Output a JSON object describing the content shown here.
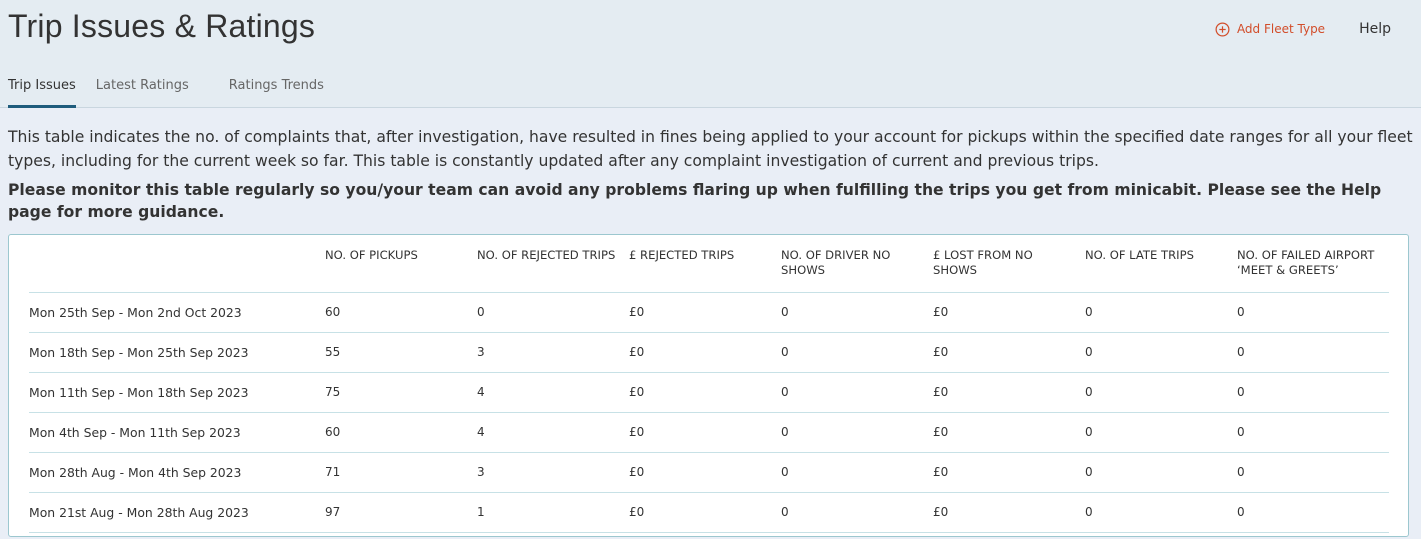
{
  "header": {
    "title": "Trip Issues & Ratings",
    "add_fleet_label": "Add Fleet Type",
    "help_label": "Help"
  },
  "tabs": [
    {
      "label": "Trip Issues",
      "active": true
    },
    {
      "label": "Latest Ratings",
      "active": false
    },
    {
      "label": "Ratings Trends",
      "active": false
    }
  ],
  "intro": {
    "description": "This table indicates the no. of complaints that, after investigation, have resulted in fines being applied to your account for pickups within the specified date ranges for all your fleet types, including for the current week so far. This table is constantly updated after any complaint investigation of current and previous trips.",
    "note": "Please monitor this table regularly so you/your team can avoid any problems flaring up when fulfilling the trips you get from minicabit. Please see the Help page for more guidance."
  },
  "table": {
    "columns": [
      "",
      "NO. OF PICKUPS",
      "NO. OF REJECTED TRIPS",
      "£ REJECTED TRIPS",
      "NO. OF DRIVER NO SHOWS",
      "£ LOST FROM NO SHOWS",
      "NO. OF LATE TRIPS",
      "NO. OF FAILED AIRPORT ‘MEET & GREETS’"
    ],
    "rows": [
      [
        "Mon 25th Sep - Mon 2nd Oct 2023",
        "60",
        "0",
        "£0",
        "0",
        "£0",
        "0",
        "0"
      ],
      [
        "Mon 18th Sep - Mon 25th Sep 2023",
        "55",
        "3",
        "£0",
        "0",
        "£0",
        "0",
        "0"
      ],
      [
        "Mon 11th Sep - Mon 18th Sep 2023",
        "75",
        "4",
        "£0",
        "0",
        "£0",
        "0",
        "0"
      ],
      [
        "Mon 4th Sep - Mon 11th Sep 2023",
        "60",
        "4",
        "£0",
        "0",
        "£0",
        "0",
        "0"
      ],
      [
        "Mon 28th Aug - Mon 4th Sep 2023",
        "71",
        "3",
        "£0",
        "0",
        "£0",
        "0",
        "0"
      ],
      [
        "Mon 21st Aug - Mon 28th Aug 2023",
        "97",
        "1",
        "£0",
        "0",
        "£0",
        "0",
        "0"
      ]
    ]
  },
  "colors": {
    "accent": "#d24d2a",
    "tab_indicator": "#1e5c7c",
    "table_border": "#9cc7cf"
  },
  "icons": {
    "add_fleet": "plus-circle-icon"
  }
}
